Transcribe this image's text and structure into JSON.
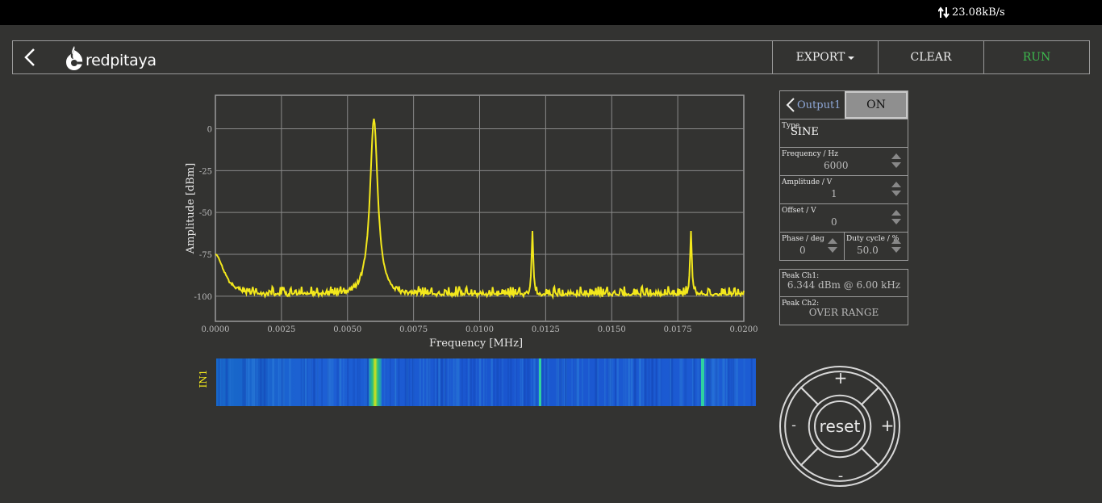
{
  "status": {
    "net_speed": "23.08kB/s"
  },
  "header": {
    "logo_text": "redpitaya",
    "export_label": "EXPORT",
    "clear_label": "CLEAR",
    "run_label": "RUN"
  },
  "plot": {
    "ylabel": "Amplitude  [dBm]",
    "xlabel": "Frequency    [MHz]",
    "waterfall_label": "IN1"
  },
  "generator": {
    "output_label": "Output1",
    "on_label": "ON",
    "type_label": "Type",
    "type_value": "SINE",
    "frequency_label": "Frequency   / Hz",
    "frequency_value": "6000",
    "amplitude_label": "Amplitude  / V",
    "amplitude_value": "1",
    "offset_label": "Offset  / V",
    "offset_value": "0",
    "phase_label": "Phase    / deg",
    "phase_value": "0",
    "duty_label": "Duty cycle  / %",
    "duty_value": "50.0"
  },
  "peaks": {
    "ch1_label": "Peak  Ch1:",
    "ch1_value": "6.344  dBm @ 6.00  kHz",
    "ch2_label": "Peak  Ch2:",
    "ch2_value": "OVER RANGE"
  },
  "controls": {
    "reset_label": "reset",
    "plus_label": "+",
    "minus_label": "-",
    "up_label": "+",
    "down_label": "-"
  },
  "colors": {
    "trace": "#f3e81c",
    "run": "#3dbb4e",
    "background": "#333331"
  },
  "chart_data": {
    "type": "line",
    "xlabel": "Frequency    [MHz]",
    "ylabel": "Amplitude  [dBm]",
    "xlim": [
      0,
      0.02
    ],
    "ylim": [
      -115,
      20
    ],
    "xticks": [
      "0.0000",
      "0.0025",
      "0.0050",
      "0.0075",
      "0.0100",
      "0.0125",
      "0.0150",
      "0.0175",
      "0.0200"
    ],
    "yticks": [
      "0",
      "-25",
      "-50",
      "-75",
      "-100"
    ],
    "ytick_values": [
      0,
      -25,
      -50,
      -75,
      -100
    ],
    "grid": true,
    "noise_floor": -100,
    "peaks": [
      {
        "x": 0.0,
        "y": -75
      },
      {
        "x": 0.006,
        "y": 6
      },
      {
        "x": 0.012,
        "y": -61
      },
      {
        "x": 0.018,
        "y": -61
      }
    ]
  }
}
